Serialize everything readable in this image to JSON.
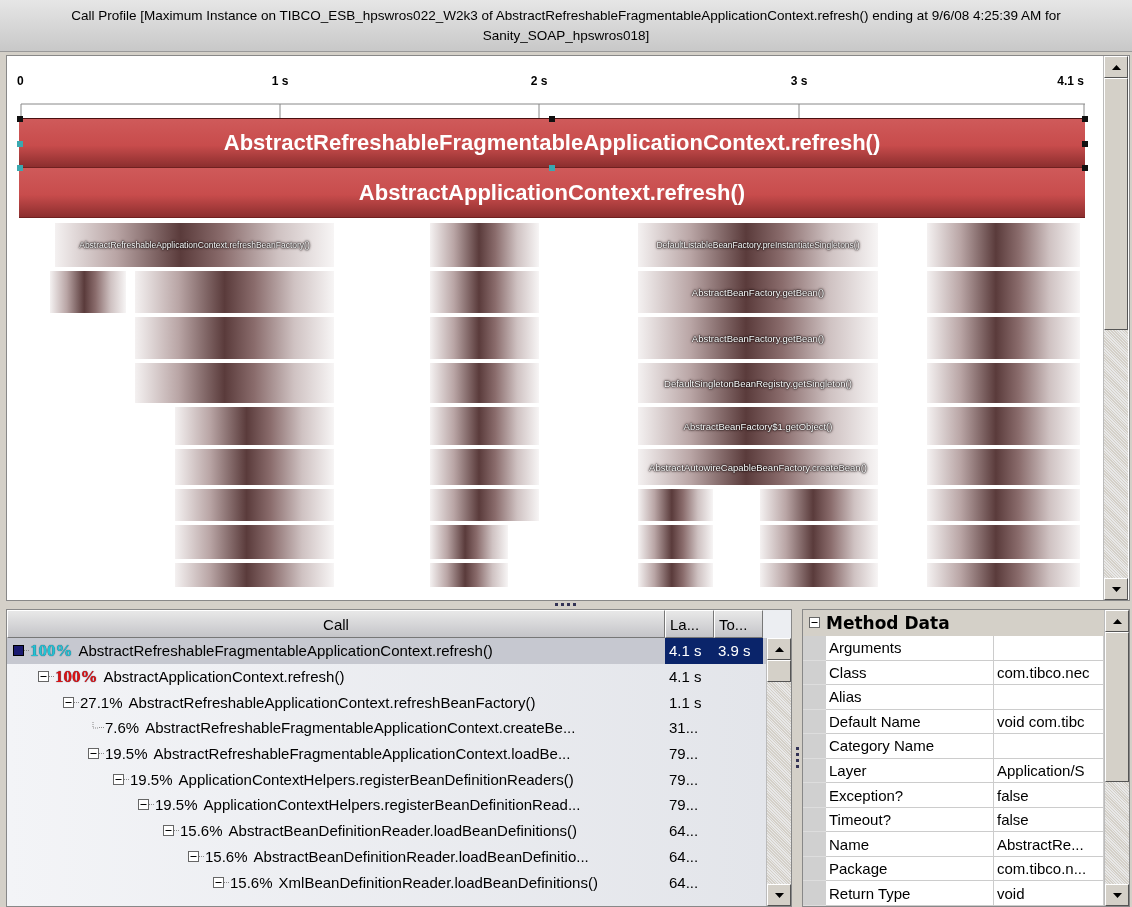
{
  "window": {
    "title": "Call Profile [Maximum Instance on TIBCO_ESB_hpswros022_W2k3 of AbstractRefreshableFragmentableApplicationContext.refresh() ending at 9/6/08 4:25:39 AM for Sanity_SOAP_hpswros018]"
  },
  "timeline": {
    "ticks": [
      "0",
      "1 s",
      "2 s",
      "3 s",
      "4.1 s"
    ],
    "bars": [
      {
        "label": "AbstractRefreshableFragmentableApplicationContext.refresh()",
        "selected": true
      },
      {
        "label": "AbstractApplicationContext.refresh()",
        "selected": false
      }
    ],
    "frames": [
      {
        "label": "AbstractRefreshableApplicationContext.refreshBeanFactory()"
      },
      {
        "label": "DefaultListableBeanFactory.preInstantiateSingletons()"
      },
      {
        "label": "AbstractBeanFactory.getBean()"
      },
      {
        "label": "AbstractBeanFactory.getBean()"
      },
      {
        "label": "DefaultSingletonBeanRegistry.getSingleton()"
      },
      {
        "label": "AbstractBeanFactory$1.getObject()"
      },
      {
        "label": "AbstractAutowireCapableBeanFactory.createBean()"
      }
    ]
  },
  "call_tree": {
    "columns": [
      "Call",
      "La...",
      "To..."
    ],
    "rows": [
      {
        "kind": "root",
        "percent": "100%",
        "color": "#22c4d4",
        "name": "AbstractRefreshableFragmentableApplicationContext.refresh()",
        "values": [
          "4.1 s",
          "3.9 s"
        ],
        "selected": true,
        "children": [
          {
            "kind": "node",
            "percent": "100%",
            "color": "#e01010",
            "name": "AbstractApplicationContext.refresh()",
            "values": [
              "4.1 s"
            ],
            "selected": false,
            "children": [
              {
                "kind": "node",
                "percent": "27.1%",
                "name": "AbstractRefreshableApplicationContext.refreshBeanFactory()",
                "values": [
                  "1.1 s"
                ],
                "selected": false,
                "children": [
                  {
                    "kind": "leaf",
                    "percent": "7.6%",
                    "name": "AbstractRefreshableFragmentableApplicationContext.createBe...",
                    "values": [
                      "31..."
                    ],
                    "selected": false
                  },
                  {
                    "kind": "node",
                    "percent": "19.5%",
                    "name": "AbstractRefreshableFragmentableApplicationContext.loadBe...",
                    "values": [
                      "79..."
                    ],
                    "selected": false,
                    "children": [
                      {
                        "kind": "node",
                        "percent": "19.5%",
                        "name": "ApplicationContextHelpers.registerBeanDefinitionReaders()",
                        "values": [
                          "79..."
                        ],
                        "selected": false,
                        "children": [
                          {
                            "kind": "node",
                            "percent": "19.5%",
                            "name": "ApplicationContextHelpers.registerBeanDefinitionRead...",
                            "values": [
                              "79..."
                            ],
                            "selected": false,
                            "children": [
                              {
                                "kind": "node",
                                "percent": "15.6%",
                                "name": "AbstractBeanDefinitionReader.loadBeanDefinitions()",
                                "values": [
                                  "64..."
                                ],
                                "selected": false,
                                "children": [
                                  {
                                    "kind": "node",
                                    "percent": "15.6%",
                                    "name": "AbstractBeanDefinitionReader.loadBeanDefinitio...",
                                    "values": [
                                      "64..."
                                    ],
                                    "selected": false,
                                    "children": [
                                      {
                                        "kind": "node",
                                        "percent": "15.6%",
                                        "name": "XmlBeanDefinitionReader.loadBeanDefinitions()",
                                        "values": [
                                          "64..."
                                        ],
                                        "selected": false
                                      }
                                    ]
                                  }
                                ]
                              }
                            ]
                          }
                        ]
                      }
                    ]
                  }
                ]
              }
            ]
          }
        ]
      }
    ]
  },
  "method_data": {
    "title": "Method Data",
    "properties": [
      {
        "name": "Arguments"
      },
      {
        "name": "Class",
        "value": "com.tibco.nec"
      },
      {
        "name": "Alias"
      },
      {
        "name": "Default Name",
        "value": "void com.tibc"
      },
      {
        "name": "Category Name"
      },
      {
        "name": "Layer",
        "value": "Application/S"
      },
      {
        "name": "Exception?",
        "value": "false"
      },
      {
        "name": "Timeout?",
        "value": "false"
      },
      {
        "name": "Name",
        "value": "AbstractRe..."
      },
      {
        "name": "Package",
        "value": "com.tibco.n..."
      },
      {
        "name": "Return Type",
        "value": "void"
      }
    ]
  }
}
